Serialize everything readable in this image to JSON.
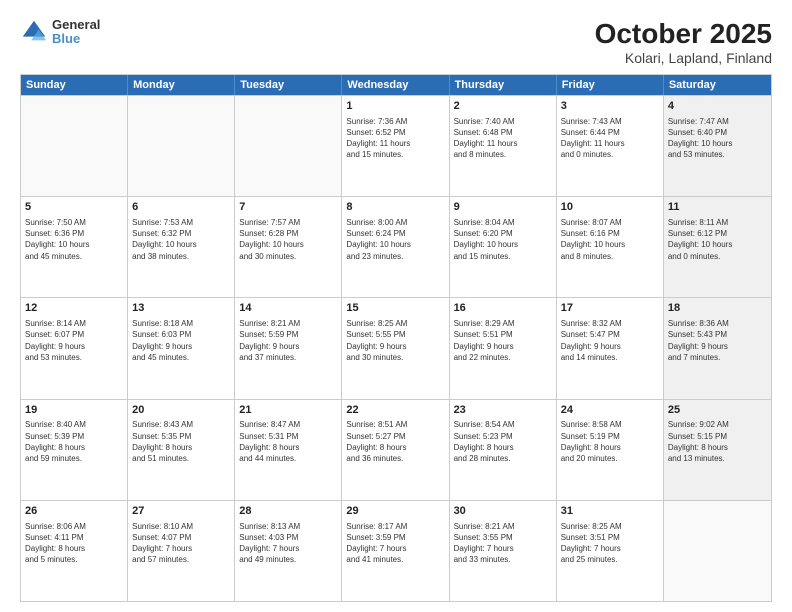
{
  "header": {
    "logo_line1": "General",
    "logo_line2": "Blue",
    "title": "October 2025",
    "subtitle": "Kolari, Lapland, Finland"
  },
  "weekdays": [
    "Sunday",
    "Monday",
    "Tuesday",
    "Wednesday",
    "Thursday",
    "Friday",
    "Saturday"
  ],
  "rows": [
    [
      {
        "day": "",
        "text": "",
        "shaded": true
      },
      {
        "day": "",
        "text": "",
        "shaded": true
      },
      {
        "day": "",
        "text": "",
        "shaded": true
      },
      {
        "day": "1",
        "text": "Sunrise: 7:36 AM\nSunset: 6:52 PM\nDaylight: 11 hours\nand 15 minutes."
      },
      {
        "day": "2",
        "text": "Sunrise: 7:40 AM\nSunset: 6:48 PM\nDaylight: 11 hours\nand 8 minutes."
      },
      {
        "day": "3",
        "text": "Sunrise: 7:43 AM\nSunset: 6:44 PM\nDaylight: 11 hours\nand 0 minutes."
      },
      {
        "day": "4",
        "text": "Sunrise: 7:47 AM\nSunset: 6:40 PM\nDaylight: 10 hours\nand 53 minutes.",
        "shaded": true
      }
    ],
    [
      {
        "day": "5",
        "text": "Sunrise: 7:50 AM\nSunset: 6:36 PM\nDaylight: 10 hours\nand 45 minutes."
      },
      {
        "day": "6",
        "text": "Sunrise: 7:53 AM\nSunset: 6:32 PM\nDaylight: 10 hours\nand 38 minutes."
      },
      {
        "day": "7",
        "text": "Sunrise: 7:57 AM\nSunset: 6:28 PM\nDaylight: 10 hours\nand 30 minutes."
      },
      {
        "day": "8",
        "text": "Sunrise: 8:00 AM\nSunset: 6:24 PM\nDaylight: 10 hours\nand 23 minutes."
      },
      {
        "day": "9",
        "text": "Sunrise: 8:04 AM\nSunset: 6:20 PM\nDaylight: 10 hours\nand 15 minutes."
      },
      {
        "day": "10",
        "text": "Sunrise: 8:07 AM\nSunset: 6:16 PM\nDaylight: 10 hours\nand 8 minutes."
      },
      {
        "day": "11",
        "text": "Sunrise: 8:11 AM\nSunset: 6:12 PM\nDaylight: 10 hours\nand 0 minutes.",
        "shaded": true
      }
    ],
    [
      {
        "day": "12",
        "text": "Sunrise: 8:14 AM\nSunset: 6:07 PM\nDaylight: 9 hours\nand 53 minutes."
      },
      {
        "day": "13",
        "text": "Sunrise: 8:18 AM\nSunset: 6:03 PM\nDaylight: 9 hours\nand 45 minutes."
      },
      {
        "day": "14",
        "text": "Sunrise: 8:21 AM\nSunset: 5:59 PM\nDaylight: 9 hours\nand 37 minutes."
      },
      {
        "day": "15",
        "text": "Sunrise: 8:25 AM\nSunset: 5:55 PM\nDaylight: 9 hours\nand 30 minutes."
      },
      {
        "day": "16",
        "text": "Sunrise: 8:29 AM\nSunset: 5:51 PM\nDaylight: 9 hours\nand 22 minutes."
      },
      {
        "day": "17",
        "text": "Sunrise: 8:32 AM\nSunset: 5:47 PM\nDaylight: 9 hours\nand 14 minutes."
      },
      {
        "day": "18",
        "text": "Sunrise: 8:36 AM\nSunset: 5:43 PM\nDaylight: 9 hours\nand 7 minutes.",
        "shaded": true
      }
    ],
    [
      {
        "day": "19",
        "text": "Sunrise: 8:40 AM\nSunset: 5:39 PM\nDaylight: 8 hours\nand 59 minutes."
      },
      {
        "day": "20",
        "text": "Sunrise: 8:43 AM\nSunset: 5:35 PM\nDaylight: 8 hours\nand 51 minutes."
      },
      {
        "day": "21",
        "text": "Sunrise: 8:47 AM\nSunset: 5:31 PM\nDaylight: 8 hours\nand 44 minutes."
      },
      {
        "day": "22",
        "text": "Sunrise: 8:51 AM\nSunset: 5:27 PM\nDaylight: 8 hours\nand 36 minutes."
      },
      {
        "day": "23",
        "text": "Sunrise: 8:54 AM\nSunset: 5:23 PM\nDaylight: 8 hours\nand 28 minutes."
      },
      {
        "day": "24",
        "text": "Sunrise: 8:58 AM\nSunset: 5:19 PM\nDaylight: 8 hours\nand 20 minutes."
      },
      {
        "day": "25",
        "text": "Sunrise: 9:02 AM\nSunset: 5:15 PM\nDaylight: 8 hours\nand 13 minutes.",
        "shaded": true
      }
    ],
    [
      {
        "day": "26",
        "text": "Sunrise: 8:06 AM\nSunset: 4:11 PM\nDaylight: 8 hours\nand 5 minutes."
      },
      {
        "day": "27",
        "text": "Sunrise: 8:10 AM\nSunset: 4:07 PM\nDaylight: 7 hours\nand 57 minutes."
      },
      {
        "day": "28",
        "text": "Sunrise: 8:13 AM\nSunset: 4:03 PM\nDaylight: 7 hours\nand 49 minutes."
      },
      {
        "day": "29",
        "text": "Sunrise: 8:17 AM\nSunset: 3:59 PM\nDaylight: 7 hours\nand 41 minutes."
      },
      {
        "day": "30",
        "text": "Sunrise: 8:21 AM\nSunset: 3:55 PM\nDaylight: 7 hours\nand 33 minutes."
      },
      {
        "day": "31",
        "text": "Sunrise: 8:25 AM\nSunset: 3:51 PM\nDaylight: 7 hours\nand 25 minutes."
      },
      {
        "day": "",
        "text": "",
        "shaded": true
      }
    ]
  ]
}
